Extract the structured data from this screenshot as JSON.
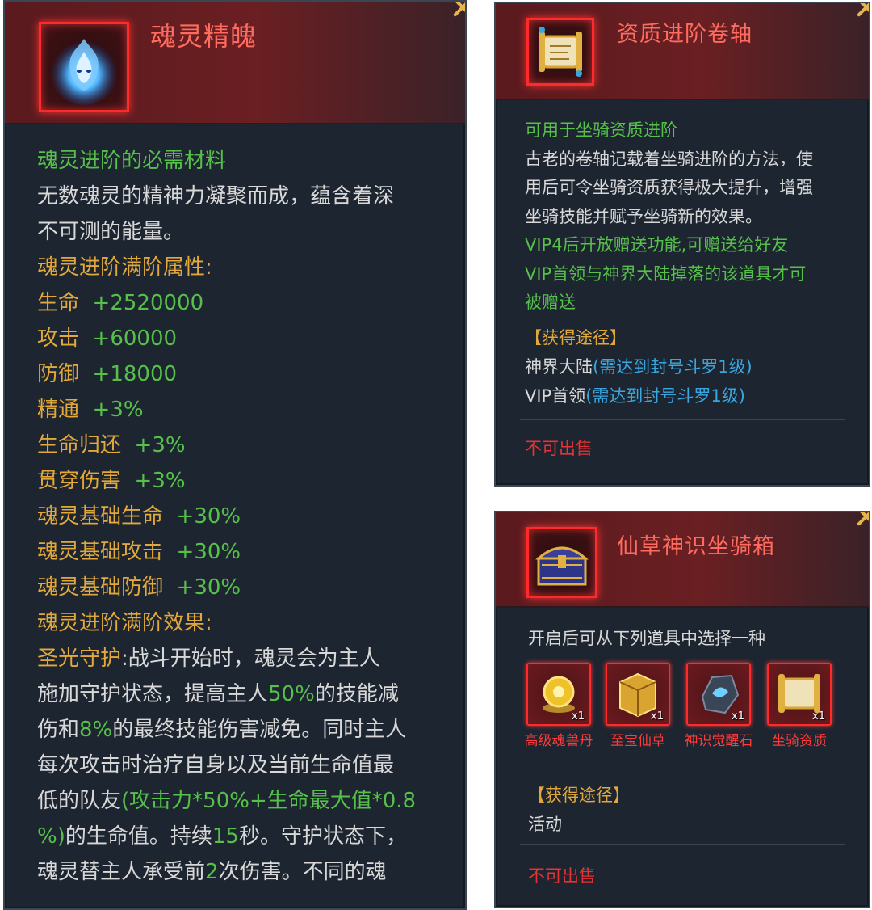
{
  "panel1": {
    "title": "魂灵精魄",
    "icon": "blue-flame-spirit-icon",
    "subtitle": "魂灵进阶的必需材料",
    "desc_line1": "无数魂灵的精神力凝聚而成，蕴含着深",
    "desc_line2": "不可测的能量。",
    "attr_heading": "魂灵进阶满阶属性:",
    "attrs": [
      {
        "name": "生命",
        "value": "+2520000"
      },
      {
        "name": "攻击",
        "value": "+60000"
      },
      {
        "name": "防御",
        "value": "+18000"
      },
      {
        "name": "精通",
        "value": "+3%"
      },
      {
        "name": "生命归还",
        "value": "+3%"
      },
      {
        "name": "贯穿伤害",
        "value": "+3%"
      },
      {
        "name": "魂灵基础生命",
        "value": "+30%"
      },
      {
        "name": "魂灵基础攻击",
        "value": "+30%"
      },
      {
        "name": "魂灵基础防御",
        "value": "+30%"
      }
    ],
    "effect_heading": "魂灵进阶满阶效果:",
    "effect": {
      "name": "圣光守护",
      "l1": ":战斗开始时，魂灵会为主人",
      "l2a": "施加守护状态，提高主人",
      "l2b": "50%",
      "l2c": "的技能减",
      "l3a": "伤和",
      "l3b": "8%",
      "l3c": "的最终技能伤害减免。同时主人",
      "l4": "每次攻击时治疗自身以及当前生命值最",
      "l5a": "低的队友",
      "l5b": "(攻击力*50%+生命最大值*0.8",
      "l6a": "%)",
      "l6b": "的生命值。持续",
      "l6c": "15",
      "l6d": "秒。守护状态下，",
      "l7a": "魂灵替主人承受前",
      "l7b": "2",
      "l7c": "次伤害。不同的魂"
    }
  },
  "panel2": {
    "title": "资质进阶卷轴",
    "icon": "golden-scroll-icon",
    "subtitle": "可用于坐骑资质进阶",
    "desc_lines": [
      "古老的卷轴记载着坐骑进阶的方法，使",
      "用后可令坐骑资质获得极大提升，增强",
      "坐骑技能并赋予坐骑新的效果。"
    ],
    "vip_lines": [
      "VIP4后开放赠送功能,可赠送给好友",
      "VIP首领与神界大陆掉落的该道具才可",
      "被赠送"
    ],
    "source_heading": "【获得途径】",
    "sources": [
      {
        "name": "神界大陆",
        "req": "(需达到封号斗罗1级)"
      },
      {
        "name": "VIP首领",
        "req": "(需达到封号斗罗1级)"
      }
    ],
    "sell": "不可出售"
  },
  "panel3": {
    "title": "仙草神识坐骑箱",
    "icon": "treasure-chest-icon",
    "desc": "开启后可从下列道具中选择一种",
    "items": [
      {
        "label": "高级魂兽丹",
        "qty": "x1",
        "icon": "golden-pill-icon"
      },
      {
        "label": "至宝仙草",
        "qty": "x1",
        "icon": "golden-box-icon"
      },
      {
        "label": "神识觉醒石",
        "qty": "x1",
        "icon": "blue-stone-icon"
      },
      {
        "label": "坐骑资质",
        "qty": "x1",
        "icon": "golden-scroll-icon"
      }
    ],
    "source_heading": "【获得途径】",
    "source": "活动",
    "sell": "不可出售"
  }
}
